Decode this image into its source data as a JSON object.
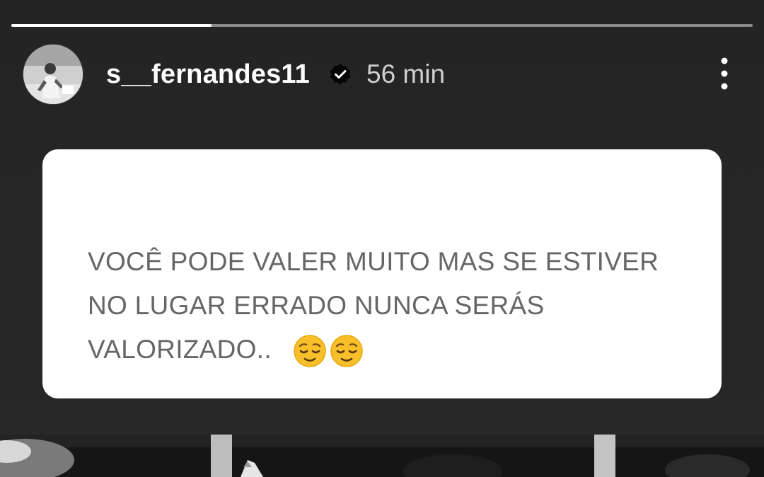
{
  "story": {
    "progress": 0.27
  },
  "header": {
    "username": "s__fernandes11",
    "verified_icon": "verified-badge-icon",
    "timestamp": "56 min",
    "more_icon": "more-vertical-icon"
  },
  "card": {
    "lines": [
      "VOCÊ PODE VALER MUITO MAS SE ESTIVER",
      "NO LUGAR ERRADO NUNCA SERÁS",
      "VALORIZADO.."
    ],
    "emoji_icon": "relieved-face-emoji-icon"
  },
  "colors": {
    "background": "#262626",
    "card": "#ffffff",
    "card_text": "#666666",
    "timestamp": "#cfcfcf",
    "emoji": "#f7c02b"
  }
}
